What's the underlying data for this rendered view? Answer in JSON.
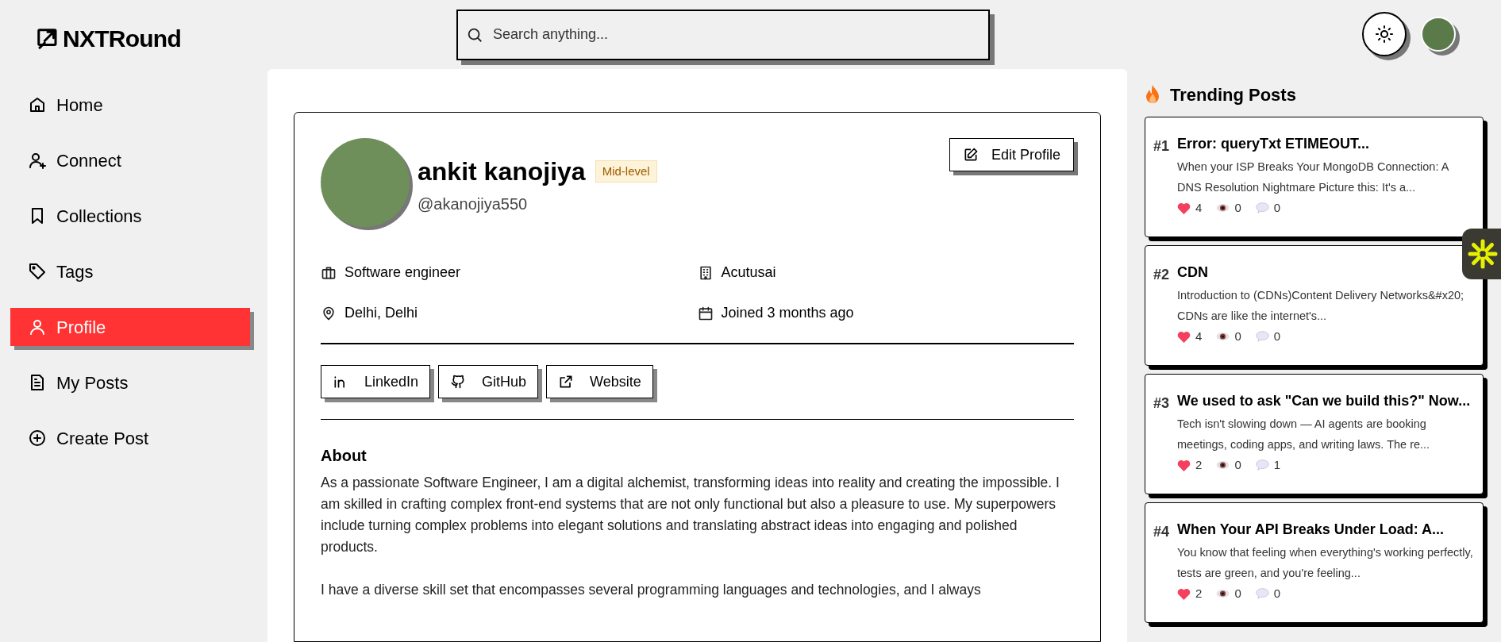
{
  "header": {
    "logo": "NXTRound",
    "search": {
      "placeholder": "Search anything..."
    }
  },
  "sidebar": {
    "items": [
      {
        "label": "Home",
        "kind": "home",
        "selected": false
      },
      {
        "label": "Connect",
        "kind": "connect",
        "selected": false
      },
      {
        "label": "Collections",
        "kind": "collections",
        "selected": false
      },
      {
        "label": "Tags",
        "kind": "tags",
        "selected": false
      },
      {
        "label": "Profile",
        "kind": "profile",
        "selected": true
      },
      {
        "label": "My Posts",
        "kind": "posts",
        "selected": false
      },
      {
        "label": "Create Post",
        "kind": "create",
        "selected": false
      }
    ]
  },
  "profile": {
    "name": "ankit kanojiya",
    "level_badge": "Mid-level",
    "handle": "@akanojiya550",
    "edit_button": "Edit Profile",
    "details": [
      {
        "kind": "role",
        "text": "Software engineer"
      },
      {
        "kind": "company",
        "text": "Acutusai"
      },
      {
        "kind": "location",
        "text": "Delhi, Delhi"
      },
      {
        "kind": "joined",
        "text": "Joined 3 months ago"
      }
    ],
    "links": [
      {
        "kind": "linkedin",
        "label": "LinkedIn"
      },
      {
        "kind": "github",
        "label": "GitHub"
      },
      {
        "kind": "website",
        "label": "Website"
      }
    ],
    "about": {
      "title": "About",
      "paragraphs": [
        "As a passionate Software Engineer, I am a digital alchemist, transforming ideas into reality and creating the impossible. I am skilled in crafting complex front-end systems that are not only functional but also a pleasure to use. My superpowers include turning complex problems into elegant solutions and translating abstract ideas into engaging and polished products.",
        "I have a diverse skill set that encompasses several programming languages and technologies, and I always"
      ]
    }
  },
  "trending": {
    "title": "Trending Posts",
    "posts": [
      {
        "rank": "#1",
        "title": "Error: queryTxt ETIMEOUT...",
        "excerpt": "When your ISP Breaks Your MongoDB Connection: A DNS Resolution Nightmare Picture this: It's a...",
        "likes": "4",
        "views": "0",
        "comments": "0"
      },
      {
        "rank": "#2",
        "title": "CDN",
        "excerpt": "Introduction to (CDNs)Content Delivery Networks&#x20; CDNs are like the internet's...",
        "likes": "4",
        "views": "0",
        "comments": "0"
      },
      {
        "rank": "#3",
        "title": "We used to ask \"Can we build this?\" Now...",
        "excerpt": "Tech isn't slowing down — AI agents are booking meetings, coding apps, and writing laws. The re...",
        "likes": "2",
        "views": "0",
        "comments": "1"
      },
      {
        "rank": "#4",
        "title": "When Your API Breaks Under Load: A...",
        "excerpt": "You know that feeling when everything's working perfectly, tests are green, and you're feeling...",
        "likes": "2",
        "views": "0",
        "comments": "0"
      }
    ]
  }
}
